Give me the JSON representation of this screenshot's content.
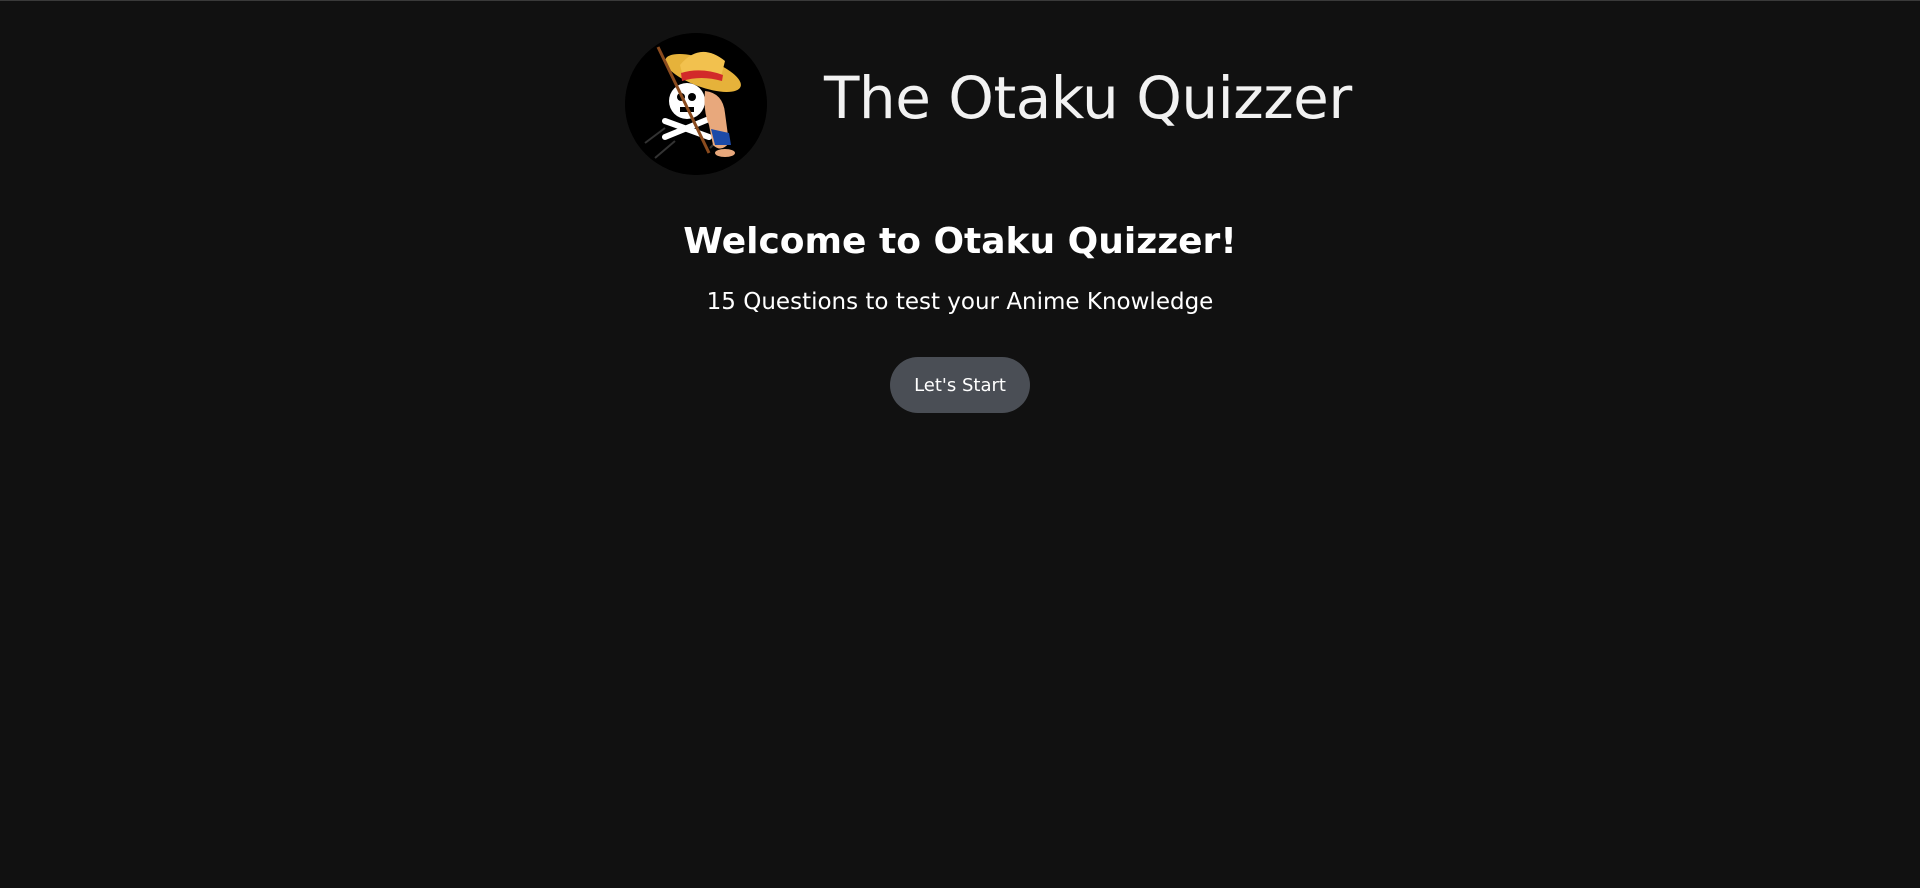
{
  "header": {
    "logo_icon": "straw-hat-pirate-logo-icon",
    "title": "The Otaku Quizzer"
  },
  "main": {
    "welcome_heading": "Welcome to Otaku Quizzer!",
    "subtitle": "15 Questions to test your Anime Knowledge",
    "start_button_label": "Let's Start"
  },
  "colors": {
    "background": "#111111",
    "button_background": "#4a4e55",
    "text": "#ffffff"
  }
}
